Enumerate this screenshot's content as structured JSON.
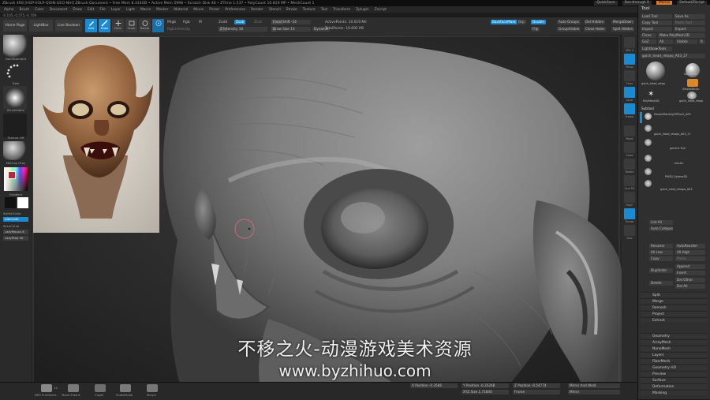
{
  "titlebar": {
    "title": "ZBrush 4R8 [HOP-VOLP-QOIN-GEO-NIH]   ZBrush Document   • Free Mem 8.333GB • Active Mem 5998 • Scratch Disk 48 • ZTime 1.537 • PolyCount 10.819 MP • MeshCount 1",
    "quicksave": "QuickSave",
    "see_through": "See-through  0",
    "menus": "Menus",
    "default_script": "DefaultZScript"
  },
  "menubar": [
    "Alpha",
    "Brush",
    "Color",
    "Document",
    "Draw",
    "Edit",
    "File",
    "Layer",
    "Light",
    "Macro",
    "Marker",
    "Material",
    "Movie",
    "Picker",
    "Preferences",
    "Render",
    "Stencil",
    "Stroke",
    "Texture",
    "Tool",
    "Transform",
    "Zplugin",
    "Zscript"
  ],
  "coords": "-0.105,-0.575,-0.709",
  "toolbar": {
    "home_page": "Home Page",
    "lightbox": "LightBox",
    "live_boolean": "Live Boolean",
    "edit": "Edit",
    "draw": "Draw",
    "move": "Move",
    "scale": "Scale",
    "rotate": "Rotate",
    "mrgb": "Mrgb",
    "rgb": "Rgb",
    "m": "M",
    "rgb_intensity": "Rgb Intensity",
    "zadd": "Zadd",
    "zsub": "Zsub",
    "zcut": "Zcut",
    "z_intensity": "Z Intensity 18",
    "focal_shift": "Focal Shift -54",
    "draw_size": "Draw Size 13",
    "dynamic": "Dynamic",
    "active_points": "ActivePoints: 10.019 Mil",
    "total_points": "TotalPoints: 10.692 Mil",
    "backface_mask": "BackfaceMask",
    "grp": "Grp",
    "double": "Double",
    "flip": "Flip",
    "auto_groups": "Auto Groups",
    "group_visible": "GroupVisible",
    "del_hidden": "Del Hidden",
    "close_holes": "Close Holes",
    "merge_down": "MergeDown",
    "split_hidden": "Split Hidden"
  },
  "leftshelf": {
    "brush1": "DamStandard",
    "brush2": "Dots",
    "brush3": "BrushAlpha",
    "texture": "Texture Off",
    "material": "MatCap Gray",
    "gradient": "Gradient",
    "switch_color": "SwitchColor",
    "alternate": "Alternate",
    "accu_curve": "AccuCurve",
    "spray": "LazyMouse 8",
    "lazystep": "LazyStep 40"
  },
  "rightstrip": [
    "SPix 3",
    "Persp",
    "Floor",
    "Local",
    "Frame",
    "Move",
    "Scale",
    "Rotate",
    "Line Fill",
    "PolyF",
    "Transp",
    "Solo"
  ],
  "palette": {
    "title": "Tool",
    "load_tool": "Load Tool",
    "save_as": "Save As",
    "copy_tool": "Copy Tool",
    "paste_tool": "Paste Tool",
    "import": "Import",
    "export": "Export",
    "clone": "Clone",
    "make_polymesh": "Make PolyMesh3D",
    "goz": "GoZ",
    "all": "All",
    "visible": "Visible",
    "r": "R",
    "lightbox_tools": "Lightbox▸Tools",
    "current_tool": "gulch_head_retopo_A03_27",
    "thumbs": [
      "gulch_head_retop",
      "Sphere3D",
      "SimpleBrush",
      "PolyMesh3D",
      "gulch_head_retop"
    ],
    "subtool_title": "Subtool",
    "subtools": [
      "SimplePaintingTriPlus2_A09",
      "gulch_head_retopo_A03_17",
      "generic Eye",
      "mouth",
      "PM3D_Sphere3D",
      "gulch_head_retopo_A03"
    ],
    "list_all": "List All",
    "auto_collapse": "Auto Collapse",
    "rename": "Rename",
    "auto_reorder": "AutoReorder",
    "all_low": "All Low",
    "all_high": "All High",
    "copy": "Copy",
    "paste": "Paste",
    "duplicate": "Duplicate",
    "append": "Append",
    "insert": "Insert",
    "del_other": "Del Other",
    "delete": "Delete",
    "del_all": "Del All",
    "sections": [
      "Split",
      "Merge",
      "Remesh",
      "Project",
      "Extract",
      "Geometry",
      "ArrayMesh",
      "NanoMesh",
      "Layers",
      "FiberMesh",
      "Geometry HD",
      "Preview",
      "Surface",
      "Deformation",
      "Masking"
    ]
  },
  "bottombar": {
    "brushes": [
      "IMM Primitives",
      "Move Elastic",
      "ClayB",
      "SnakeHook",
      "Morph"
    ],
    "count": "14",
    "x_position": "X Position -0.3586",
    "y_position": "Y Position -0.35268",
    "z_position": "Z Position -0.54774",
    "xyz_size": "XYZ Size 1.71840",
    "frame": "Frame",
    "mirror_weld": "Mirror And Weld",
    "mirror": "Mirror"
  },
  "watermark": {
    "line1": "不移之火-动漫游戏美术资源",
    "line2": "www.byzhihuo.com"
  },
  "colors": {
    "accent": "#1a8bd0",
    "orange": "#e0782a",
    "panel": "#2f2f2f"
  }
}
